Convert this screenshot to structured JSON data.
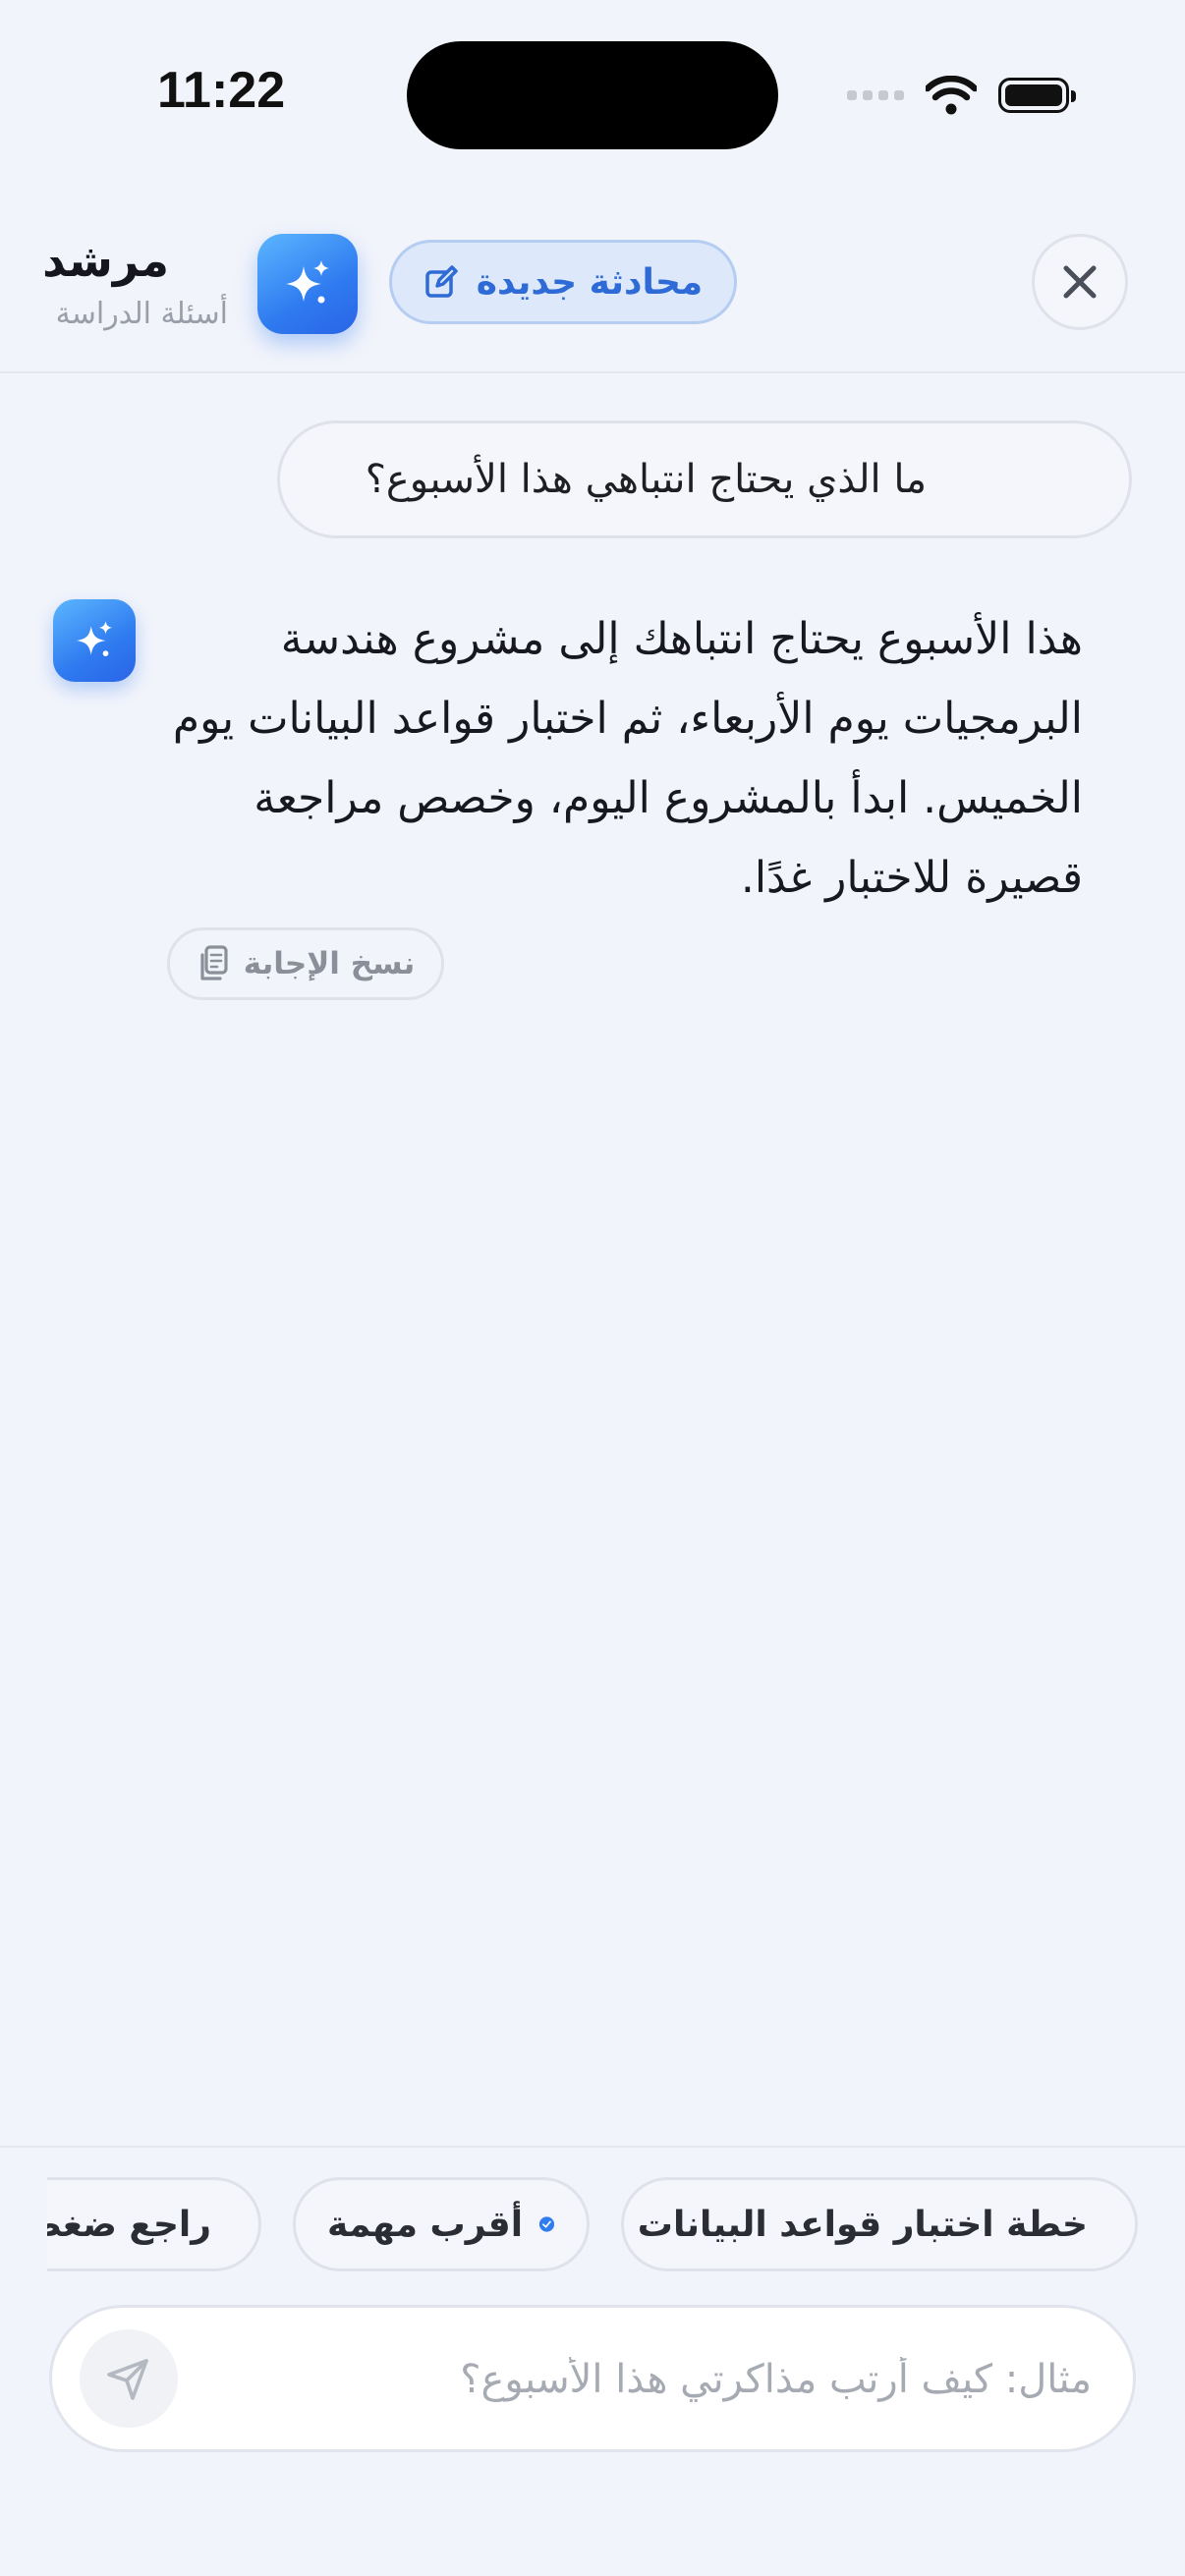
{
  "status_bar": {
    "time": "11:22"
  },
  "header": {
    "title": "مرشد",
    "subtitle": "أسئلة الدراسة",
    "new_chat_label": "محادثة جديدة"
  },
  "conversation": {
    "user_message": "ما الذي يحتاج انتباهي هذا الأسبوع؟",
    "assistant_message": "هذا الأسبوع يحتاج انتباهك إلى مشروع هندسة البرمجيات يوم الأربعاء، ثم اختبار قواعد البيانات يوم الخميس. ابدأ بالمشروع اليوم، وخصص مراجعة قصيرة للاختبار غدًا.",
    "copy_label": "نسخ الإجابة"
  },
  "suggestions": [
    {
      "label": "خطة اختبار قواعد البيانات",
      "icon": "calendar-icon"
    },
    {
      "label": "أقرب مهمة",
      "icon": "check-circle-icon"
    },
    {
      "label": "راجع ضغط الأسبوع",
      "icon": "calendar-alert-icon"
    }
  ],
  "composer": {
    "placeholder": "مثال: كيف أرتب مذاكرتي هذا الأسبوع؟"
  },
  "colors": {
    "accent": "#2f7bf0",
    "background": "#f2f4fb"
  }
}
